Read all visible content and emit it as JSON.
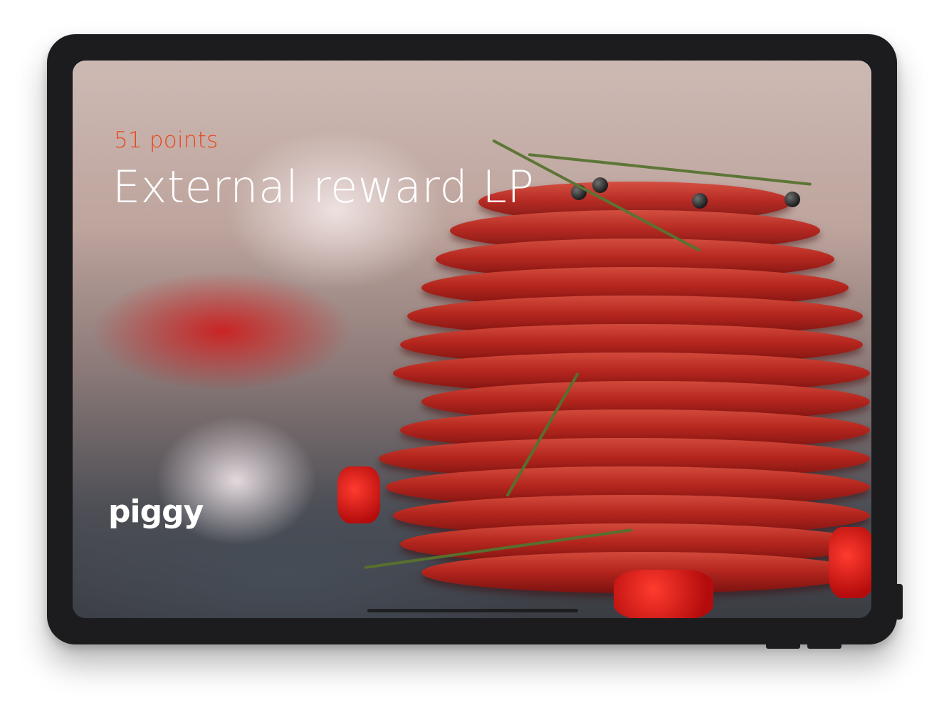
{
  "reward": {
    "points_label": "51 points",
    "title": "External reward LP"
  },
  "brand": {
    "logo_text": "piggy"
  },
  "colors": {
    "accent": "#e8481e",
    "title_text": "#ffffff",
    "device_frame": "#1c1c1e"
  }
}
